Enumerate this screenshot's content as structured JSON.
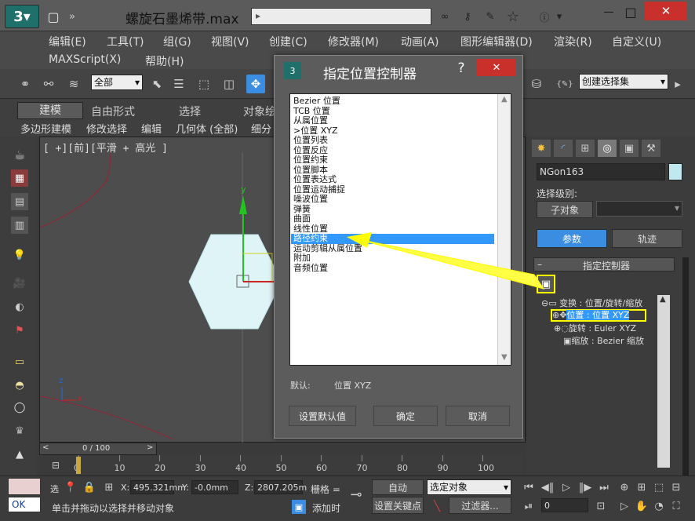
{
  "window": {
    "title": "螺旋石墨烯带.max",
    "search_field": "",
    "minimize_glyph": "—",
    "maximize_glyph": "□",
    "close_glyph": "✕"
  },
  "menu": {
    "row1": [
      "编辑(E)",
      "工具(T)",
      "组(G)",
      "视图(V)",
      "创建(C)",
      "修改器(M)",
      "动画(A)",
      "图形编辑器(D)",
      "渲染(R)",
      "自定义(U)"
    ],
    "row2": [
      "MAXScript(X)",
      "帮助(H)"
    ]
  },
  "toolbar": {
    "selection_filter": "全部",
    "named_selection": "创建选择集"
  },
  "ribbon": {
    "tabs": [
      "建模",
      "自由形式",
      "选择",
      "对象绘"
    ],
    "panels": [
      "多边形建模",
      "修改选择",
      "编辑",
      "几何体 (全部)",
      "细分"
    ]
  },
  "viewport": {
    "label": "[ +][前][平滑 + 高光 ]",
    "axis_y": "y",
    "axis_x": "x",
    "gizmo_x": "x",
    "gizmo_z": "z"
  },
  "dialog": {
    "title": "指定位置控制器",
    "help": "?",
    "close": "✕",
    "items": [
      "Bezier 位置",
      "TCB 位置",
      "从属位置",
      ">位置 XYZ",
      "位置列表",
      "位置反应",
      "位置约束",
      "位置脚本",
      "位置表达式",
      "位置运动捕捉",
      "噪波位置",
      "弹簧",
      "曲面",
      "线性位置",
      "路径约束",
      "运动剪辑从属位置",
      "附加",
      "音频位置"
    ],
    "selected_index": 14,
    "default_label": "默认:",
    "default_value": "位置 XYZ",
    "set_default": "设置默认值",
    "ok": "确定",
    "cancel": "取消"
  },
  "command_panel": {
    "object_name": "NGon163",
    "selection_level_label": "选择级别:",
    "sub_object": "子对象",
    "tab_params": "参数",
    "tab_tracks": "轨迹",
    "rollout_title": "指定控制器",
    "tree": [
      "变换 : 位置/旋转/缩放",
      "位置 : 位置 XYZ",
      "旋转 : Euler XYZ",
      "缩放 : Bezier 缩放"
    ]
  },
  "timeline": {
    "frame": "0 / 100",
    "ticks": [
      "0",
      "10",
      "20",
      "30",
      "40",
      "50",
      "60",
      "70",
      "80",
      "90",
      "100"
    ]
  },
  "status": {
    "ok_label": "OK",
    "prompt": "单击并拖动以选择并移动对象",
    "lock_label": "选",
    "x_label": "X:",
    "x_value": "495.321mm",
    "y_label": "Y:",
    "y_value": "-0.0mm",
    "z_label": "Z:",
    "z_value": "2807.205m",
    "grid_label": "栅格 =",
    "add_time": "添加时",
    "auto_key": "自动",
    "selected_object": "选定对象",
    "set_key": "设置关键点",
    "filters": "过滤器...",
    "frame_value": "0"
  },
  "colors": {
    "accent": "#3399ff",
    "highlight": "#ffff00",
    "viewport_bg": "#4d4d4d",
    "object_fill": "#dff4f6"
  }
}
